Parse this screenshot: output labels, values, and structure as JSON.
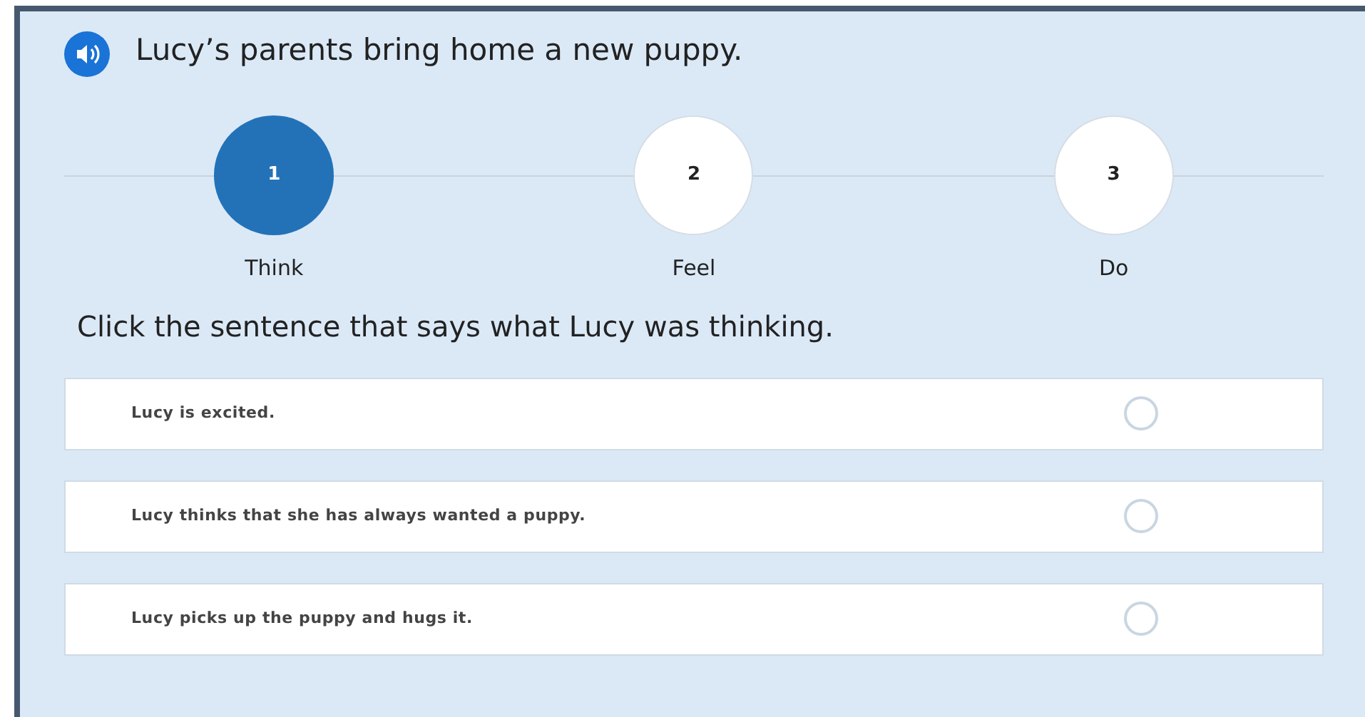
{
  "prompt": "Lucy’s parents bring home a new puppy.",
  "steps": [
    {
      "number": "1",
      "label": "Think",
      "selected": true
    },
    {
      "number": "2",
      "label": "Feel",
      "selected": false
    },
    {
      "number": "3",
      "label": "Do",
      "selected": false
    }
  ],
  "question": "Click the sentence that says what Lucy was thinking.",
  "options": [
    {
      "text": "Lucy is excited.",
      "selected": false
    },
    {
      "text": "Lucy thinks that she has always wanted a puppy.",
      "selected": false
    },
    {
      "text": "Lucy picks up the puppy and hugs it.",
      "selected": false
    }
  ]
}
